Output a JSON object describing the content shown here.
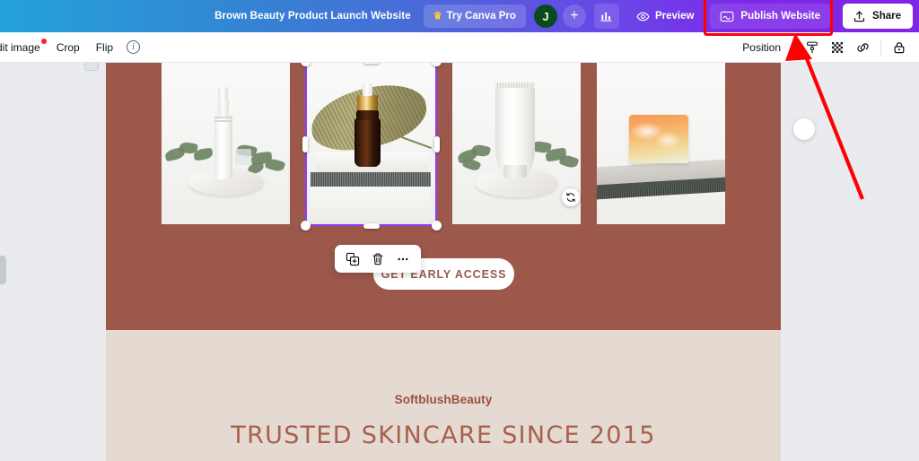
{
  "topbar": {
    "doc_title": "Brown Beauty Product Launch Website",
    "try_pro_label": "Try Canva Pro",
    "crown_icon": "crown-icon",
    "avatar_initial": "J",
    "plus_label": "+",
    "analytics_icon": "bar-chart-icon",
    "preview_label": "Preview",
    "preview_icon": "eye-icon",
    "publish_label": "Publish Website",
    "publish_icon": "publish-icon",
    "share_label": "Share",
    "share_icon": "upload-icon",
    "gradient_start": "#24A2D8",
    "gradient_end": "#8024E6",
    "highlight_color": "#FF0000"
  },
  "toolbar": {
    "edit_image_label": "dit image",
    "crop_label": "Crop",
    "flip_label": "Flip",
    "info_icon": "info-icon",
    "position_label": "Position",
    "icons": [
      {
        "name": "format-painter-icon"
      },
      {
        "name": "transparency-icon"
      },
      {
        "name": "link-icon"
      },
      {
        "name": "lock-icon"
      }
    ]
  },
  "context_toolbar": {
    "icons": [
      {
        "name": "duplicate-icon"
      },
      {
        "name": "delete-icon"
      },
      {
        "name": "more-options-icon"
      }
    ]
  },
  "canvas": {
    "background_color": "#9C584B",
    "band_color": "#E5DAD2",
    "cta_label": "GET EARLY ACCESS",
    "brand_name": "SoftblushBeauty",
    "headline": "TRUSTED SKINCARE SINCE 2015",
    "brand_color": "#9C4F3E",
    "headline_color": "#A8604E",
    "photos": [
      {
        "name": "photo-white-pump-bottle",
        "alt": "White pump bottle on marble disc with eucalyptus"
      },
      {
        "name": "photo-amber-dropper-bottle",
        "alt": "Amber dropper bottle with dried palm leaf",
        "selected": true
      },
      {
        "name": "photo-white-tube",
        "alt": "White cosmetic tube on marble disc with eucalyptus"
      },
      {
        "name": "photo-orange-soap-bar",
        "alt": "Orange marbled soap bar on grey slab"
      }
    ],
    "selection": {
      "color": "#8B3DFF",
      "rotate_icon": "rotate-handle-icon"
    }
  }
}
